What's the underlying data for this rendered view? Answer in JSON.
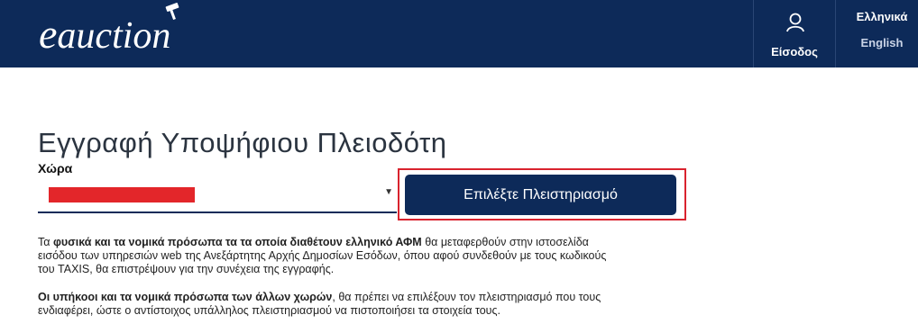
{
  "header": {
    "logo_e": "e",
    "logo_rest": "auction",
    "login_label": "Είσοδος",
    "lang_el": "Ελληνικά",
    "lang_en": "English"
  },
  "page": {
    "title": "Εγγραφή Υποψήφιου Πλειοδότη",
    "country_label": "Χώρα",
    "country_select_value": "",
    "select_button": "Επιλέξτε Πλειστηριασμό"
  },
  "info": {
    "p1_pre": "Τα ",
    "p1_bold": "φυσικά και τα νομικά πρόσωπα τα τα οποία διαθέτουν ελληνικό ΑΦΜ",
    "p1_post": " θα μεταφερθούν στην ιστοσελίδα εισόδου των υπηρεσιών web της Ανεξάρτητης Αρχής Δημοσίων Εσόδων, όπου αφού συνδεθούν με τους κωδικούς του TAXIS, θα επιστρέψουν για την συνέχεια της εγγραφής.",
    "p2_bold": "Οι υπήκοοι και τα νομικά πρόσωπα των άλλων χωρών",
    "p2_post": ", θα πρέπει να επιλέξουν τον πλειστηριασμό που τους ενδιαφέρει, ώστε ο αντίστοιχος υπάλληλος πλειστηριασμού να πιστοποιήσει τα στοιχεία τους."
  },
  "colors": {
    "navy": "#0d2a59",
    "highlight_red": "#d9232e",
    "redacted": "#e3262a"
  },
  "icons": [
    "gavel-icon",
    "user-icon",
    "dropdown-caret-icon"
  ]
}
